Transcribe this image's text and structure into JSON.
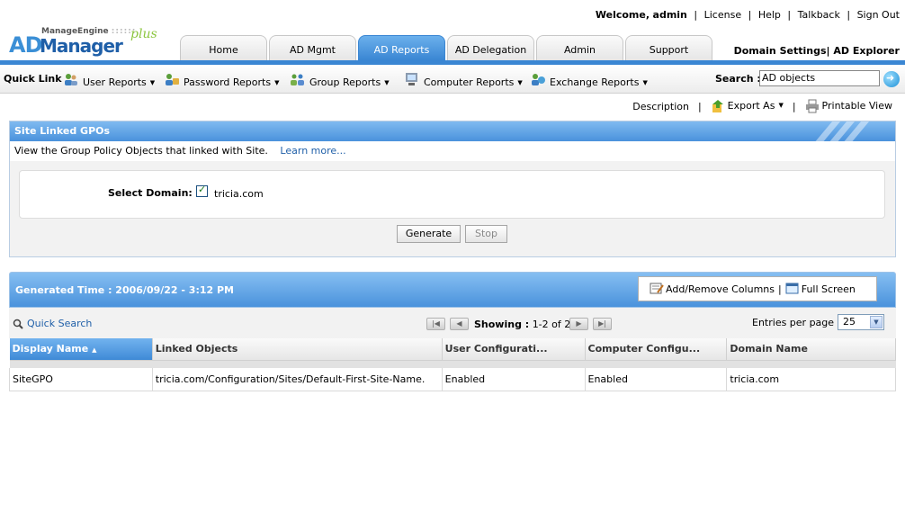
{
  "header": {
    "brand_small": "ManageEngine",
    "brand_ad": "AD",
    "brand_name": "Manager",
    "brand_plus": "plus",
    "welcome": "Welcome,",
    "user": "admin",
    "links": [
      "License",
      "Help",
      "Talkback",
      "Sign Out"
    ],
    "right_links": [
      "Domain Settings",
      "AD Explorer"
    ]
  },
  "tabs": [
    {
      "label": "Home",
      "active": false
    },
    {
      "label": "AD Mgmt",
      "active": false
    },
    {
      "label": "AD Reports",
      "active": true
    },
    {
      "label": "AD Delegation",
      "active": false
    },
    {
      "label": "Admin",
      "active": false
    },
    {
      "label": "Support",
      "active": false
    }
  ],
  "quicklinks": {
    "title": "Quick Link :",
    "items": [
      "User Reports",
      "Password Reports",
      "Group Reports",
      "Computer Reports",
      "Exchange Reports"
    ],
    "search_label": "Search :",
    "search_value": "AD objects"
  },
  "actions": {
    "description": "Description",
    "export": "Export As",
    "print": "Printable View"
  },
  "report": {
    "title": "Site Linked GPOs",
    "description": "View the Group Policy Objects that linked with Site.",
    "learn_more": "Learn more...",
    "domain_label": "Select Domain:",
    "domain_value": "tricia.com",
    "generate": "Generate",
    "stop": "Stop"
  },
  "results": {
    "generated": "Generated Time : 2006/09/22 - 3:12 PM",
    "add_remove": "Add/Remove Columns",
    "full_screen": "Full Screen",
    "quick_search": "Quick Search",
    "showing_label": "Showing :",
    "showing_value": "1-2 of 2",
    "entries_label": "Entries per page",
    "entries_value": "25",
    "columns": [
      "Display Name",
      "Linked Objects",
      "User Configurati...",
      "Computer Configu...",
      "Domain Name"
    ],
    "rows": [
      [
        "SiteGPO",
        "tricia.com/Configuration/Sites/Default-First-Site-Name.",
        "Enabled",
        "Enabled",
        "tricia.com"
      ]
    ]
  },
  "colors": {
    "accent": "#3a86d3",
    "link": "#1f5fa8"
  }
}
